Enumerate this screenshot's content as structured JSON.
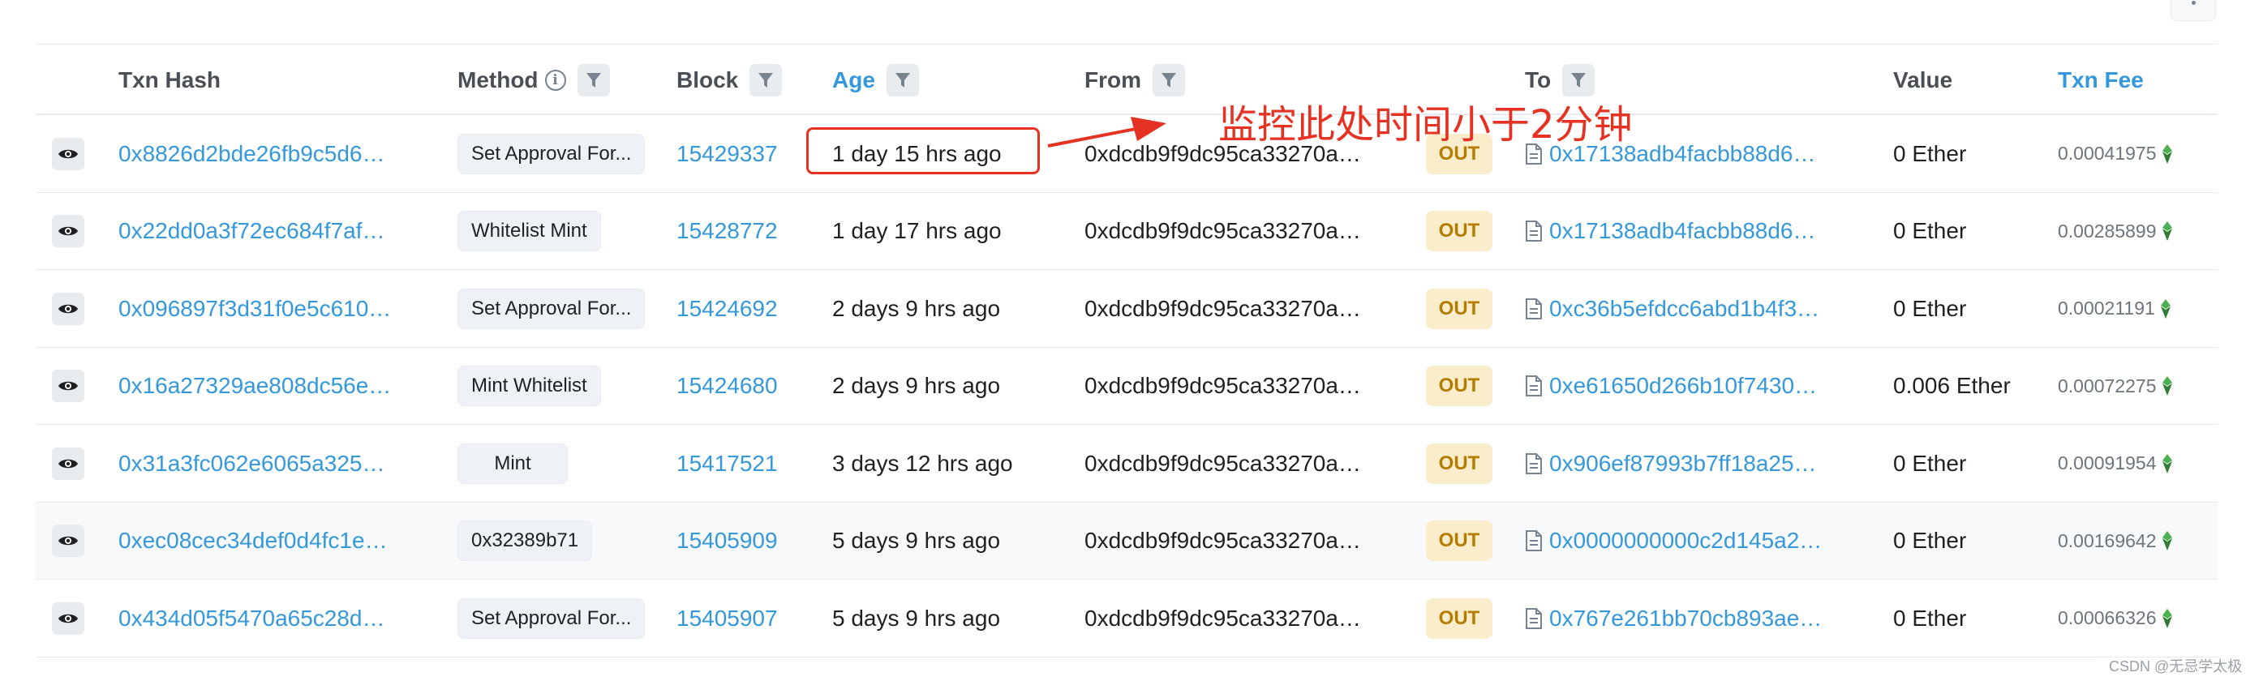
{
  "header": {
    "txn_hash": "Txn Hash",
    "method": "Method",
    "block": "Block",
    "age": "Age",
    "from": "From",
    "to": "To",
    "value": "Value",
    "txn_fee": "Txn Fee"
  },
  "rows": [
    {
      "hash": "0x8826d2bde26fb9c5d6…",
      "method": "Set Approval For...",
      "block": "15429337",
      "age": "1 day 15 hrs ago",
      "from": "0xdcdb9f9dc95ca33270a…",
      "direction": "OUT",
      "to": "0x17138adb4facbb88d6…",
      "value": "0 Ether",
      "fee": "0.00041975"
    },
    {
      "hash": "0x22dd0a3f72ec684f7af…",
      "method": "Whitelist Mint",
      "block": "15428772",
      "age": "1 day 17 hrs ago",
      "from": "0xdcdb9f9dc95ca33270a…",
      "direction": "OUT",
      "to": "0x17138adb4facbb88d6…",
      "value": "0 Ether",
      "fee": "0.00285899"
    },
    {
      "hash": "0x096897f3d31f0e5c610…",
      "method": "Set Approval For...",
      "block": "15424692",
      "age": "2 days 9 hrs ago",
      "from": "0xdcdb9f9dc95ca33270a…",
      "direction": "OUT",
      "to": "0xc36b5efdcc6abd1b4f3…",
      "value": "0 Ether",
      "fee": "0.00021191"
    },
    {
      "hash": "0x16a27329ae808dc56e…",
      "method": "Mint Whitelist",
      "block": "15424680",
      "age": "2 days 9 hrs ago",
      "from": "0xdcdb9f9dc95ca33270a…",
      "direction": "OUT",
      "to": "0xe61650d266b10f7430…",
      "value": "0.006 Ether",
      "fee": "0.00072275"
    },
    {
      "hash": "0x31a3fc062e6065a325…",
      "method": "Mint",
      "block": "15417521",
      "age": "3 days 12 hrs ago",
      "from": "0xdcdb9f9dc95ca33270a…",
      "direction": "OUT",
      "to": "0x906ef87993b7ff18a25…",
      "value": "0 Ether",
      "fee": "0.00091954"
    },
    {
      "hash": "0xec08cec34def0d4fc1e…",
      "method": "0x32389b71",
      "block": "15405909",
      "age": "5 days 9 hrs ago",
      "from": "0xdcdb9f9dc95ca33270a…",
      "direction": "OUT",
      "to": "0x0000000000c2d145a2…",
      "value": "0 Ether",
      "fee": "0.00169642"
    },
    {
      "hash": "0x434d05f5470a65c28d…",
      "method": "Set Approval For...",
      "block": "15405907",
      "age": "5 days 9 hrs ago",
      "from": "0xdcdb9f9dc95ca33270a…",
      "direction": "OUT",
      "to": "0x767e261bb70cb893ae…",
      "value": "0 Ether",
      "fee": "0.00066326"
    }
  ],
  "annotation": {
    "text": "监控此处时间小于2分钟",
    "color": "#e53222"
  },
  "watermark": "CSDN @无忌学太极",
  "colors": {
    "link": "#3498db",
    "out_badge_bg": "#fbeccc",
    "out_badge_text": "#b47d00",
    "fee_gem": "#4caf50"
  },
  "icons": {
    "row_action": "eye-icon",
    "filter": "filter-icon",
    "info": "info-icon",
    "contract": "document-icon",
    "fee": "gem-icon",
    "more": "more-icon"
  }
}
